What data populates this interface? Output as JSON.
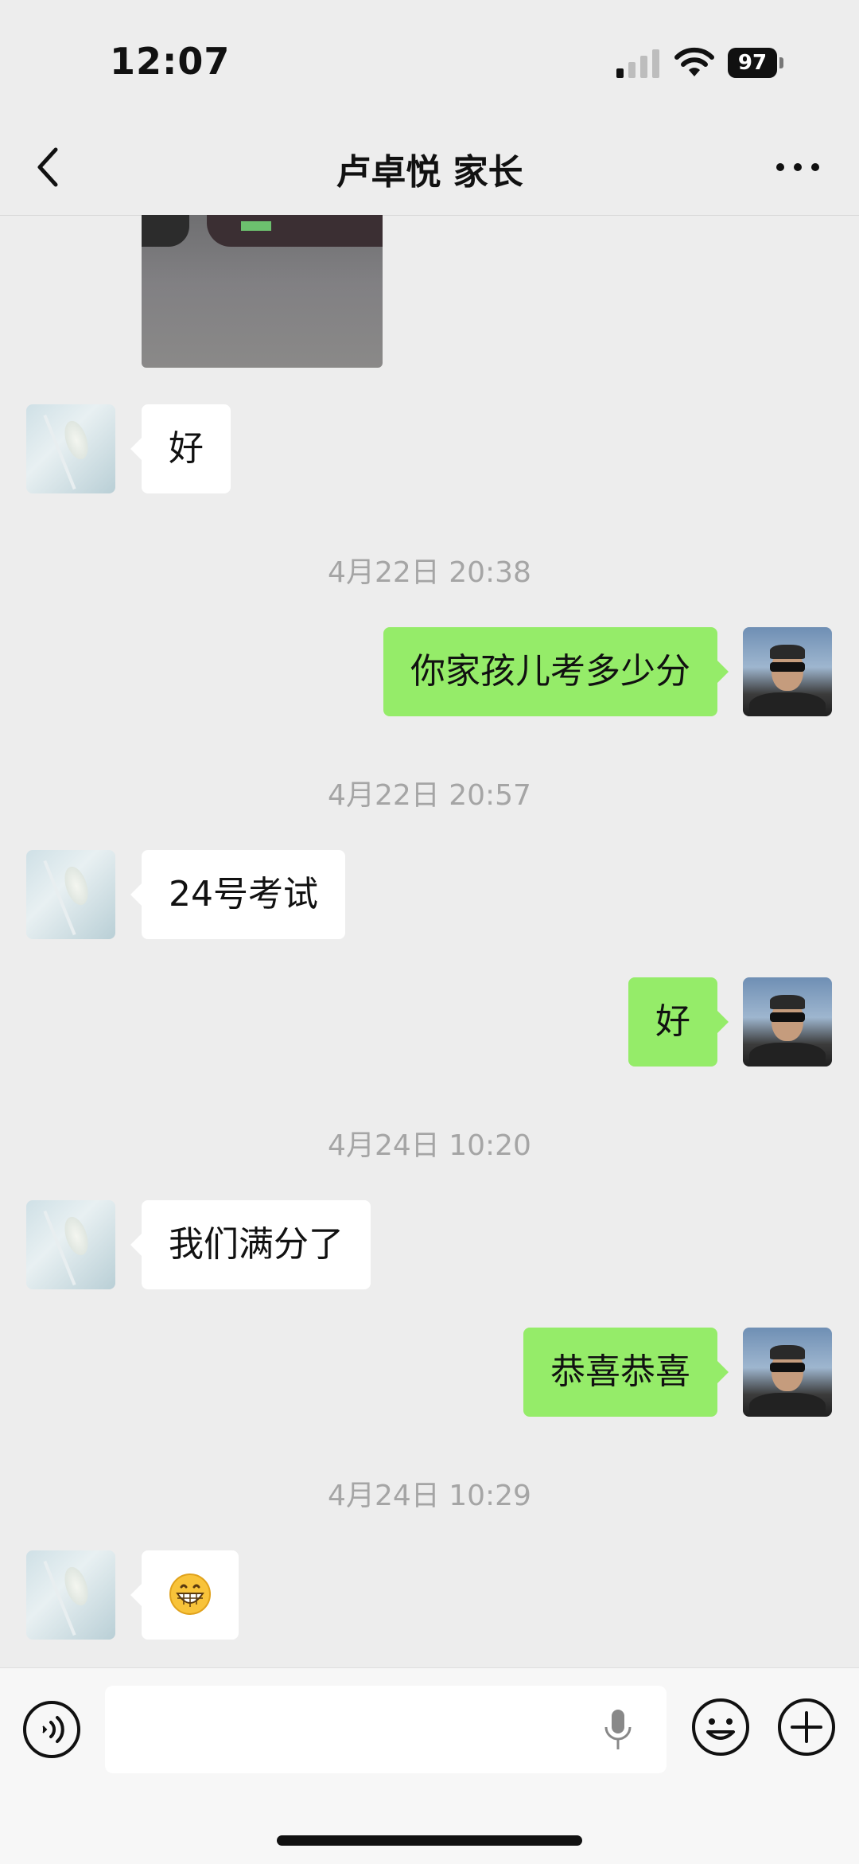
{
  "status_bar": {
    "time": "12:07",
    "battery": "97"
  },
  "nav": {
    "title": "卢卓悦 家长"
  },
  "messages": [
    {
      "type": "image",
      "sender": "other"
    },
    {
      "type": "text",
      "sender": "other",
      "text": "好"
    },
    {
      "type": "time",
      "text": "4月22日 20:38"
    },
    {
      "type": "text",
      "sender": "self",
      "text": "你家孩儿考多少分"
    },
    {
      "type": "time",
      "text": "4月22日 20:57"
    },
    {
      "type": "text",
      "sender": "other",
      "text": "24号考试"
    },
    {
      "type": "text",
      "sender": "self",
      "text": "好"
    },
    {
      "type": "time",
      "text": "4月24日 10:20"
    },
    {
      "type": "text",
      "sender": "other",
      "text": "我们满分了"
    },
    {
      "type": "text",
      "sender": "self",
      "text": "恭喜恭喜"
    },
    {
      "type": "time",
      "text": "4月24日 10:29"
    },
    {
      "type": "emoji",
      "sender": "other",
      "icon": "grinning-face-emoji"
    }
  ],
  "input": {
    "placeholder": ""
  },
  "colors": {
    "background": "#EDEDED",
    "incoming_bubble": "#FFFFFF",
    "outgoing_bubble": "#95EC69",
    "timestamp": "#A5A5A5"
  }
}
